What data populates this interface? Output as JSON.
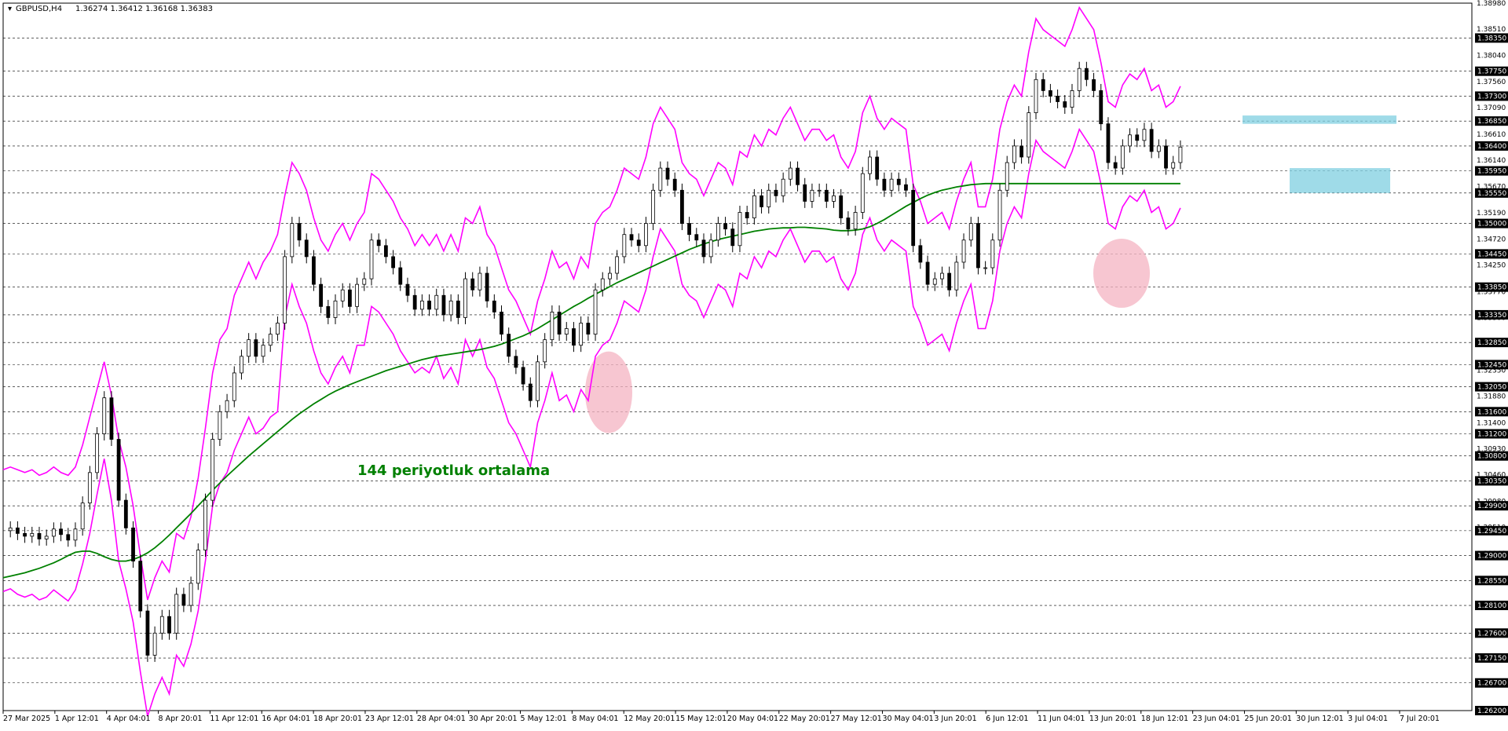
{
  "header": {
    "symbol": "GBPUSD,H4",
    "ohlc": "1.36274 1.36412 1.36168 1.36383"
  },
  "annotation": "144 periyotluk ortalama",
  "colors": {
    "background": "#ffffff",
    "candle": "#000000",
    "bollinger": "#ff00ff",
    "ma": "#008000",
    "annotation": "#008000",
    "highlight_circle": "#f4b3c2",
    "zone": "#7fcfe0"
  },
  "chart_data": {
    "type": "candlestick",
    "symbol": "GBPUSD",
    "timeframe": "H4",
    "ylim": [
      1.262,
      1.3898
    ],
    "grid": true,
    "x_ticks": [
      "27 Mar 2025",
      "1 Apr 12:01",
      "4 Apr 04:01",
      "8 Apr 20:01",
      "11 Apr 12:01",
      "16 Apr 04:01",
      "18 Apr 20:01",
      "23 Apr 12:01",
      "28 Apr 04:01",
      "30 Apr 20:01",
      "5 May 12:01",
      "8 May 04:01",
      "12 May 20:01",
      "15 May 12:01",
      "20 May 04:01",
      "22 May 20:01",
      "27 May 12:01",
      "30 May 04:01",
      "3 Jun 20:01",
      "6 Jun 12:01",
      "11 Jun 04:01",
      "13 Jun 20:01",
      "18 Jun 12:01",
      "23 Jun 04:01",
      "25 Jun 20:01",
      "30 Jun 12:01",
      "3 Jul 04:01",
      "7 Jul 20:01"
    ],
    "y_ticks_boxed": [
      "1.38350",
      "1.37750",
      "1.37300",
      "1.36850",
      "1.36400",
      "1.35950",
      "1.35550",
      "1.35000",
      "1.34450",
      "1.33850",
      "1.33350",
      "1.32850",
      "1.32450",
      "1.32050",
      "1.31600",
      "1.31200",
      "1.30800",
      "1.30350",
      "1.29900",
      "1.29450",
      "1.29000",
      "1.28550",
      "1.28100",
      "1.27600",
      "1.27150",
      "1.26700",
      "1.26200"
    ],
    "y_ticks_plain": [
      "1.38980",
      "1.38510",
      "1.38040",
      "1.37560",
      "1.37090",
      "1.36610",
      "1.36140",
      "1.35670",
      "1.35190",
      "1.34720",
      "1.34250",
      "1.33770",
      "1.33300",
      "1.32830",
      "1.32350",
      "1.31880",
      "1.31400",
      "1.30930",
      "1.30460",
      "1.29980",
      "1.29510",
      "1.29040",
      "1.28560",
      "1.28090",
      "1.27620",
      "1.27140",
      "1.26670"
    ],
    "price_series": {
      "x": [
        0,
        3,
        6,
        9,
        12,
        15,
        18,
        21,
        24,
        27,
        30,
        33,
        36,
        39,
        42,
        45,
        48,
        51,
        54,
        57,
        60,
        63,
        66,
        69,
        72,
        75,
        78,
        81,
        84,
        87,
        90,
        93,
        96,
        99,
        102,
        105,
        108,
        111,
        114,
        117,
        120,
        123,
        126,
        129,
        132,
        135,
        138,
        141,
        144,
        147,
        150,
        153,
        156,
        159,
        162,
        165,
        168,
        171,
        174,
        177,
        180,
        183,
        186,
        189,
        192,
        195,
        198,
        201,
        204,
        207,
        210,
        213,
        216,
        219,
        222,
        225,
        228,
        231,
        234,
        237,
        240,
        243,
        246,
        249,
        252,
        255,
        258,
        261,
        264,
        267,
        270,
        273,
        276,
        279,
        282,
        285,
        288,
        291,
        294,
        297,
        300,
        303,
        306,
        309,
        312,
        315,
        318,
        321,
        324,
        327,
        330,
        333,
        336,
        339,
        342,
        345,
        348,
        351,
        354,
        357,
        360,
        363,
        366,
        369,
        372,
        375,
        378,
        381,
        384,
        387,
        390,
        393,
        396,
        399,
        402,
        405,
        408,
        411,
        414,
        417,
        420,
        423,
        426,
        429,
        432,
        435,
        438,
        441,
        444,
        447,
        450,
        453,
        456,
        459,
        462,
        465,
        468,
        471,
        474,
        477,
        480,
        483,
        486,
        489,
        492,
        495,
        498,
        501,
        504,
        507,
        510,
        513,
        516,
        519,
        522,
        525,
        528,
        531,
        534,
        537,
        540,
        543,
        546,
        549,
        552,
        555,
        558,
        561,
        564,
        567
      ],
      "close": [
        1.2945,
        1.295,
        1.294,
        1.2935,
        1.294,
        1.293,
        1.2935,
        1.2948,
        1.2938,
        1.2928,
        1.2948,
        1.2995,
        1.305,
        1.312,
        1.3185,
        1.311,
        1.3,
        1.295,
        1.289,
        1.28,
        1.272,
        1.276,
        1.279,
        1.276,
        1.283,
        1.281,
        1.285,
        1.291,
        1.3,
        1.311,
        1.316,
        1.318,
        1.323,
        1.326,
        1.329,
        1.326,
        1.328,
        1.33,
        1.332,
        1.344,
        1.35,
        1.347,
        1.344,
        1.339,
        1.335,
        1.333,
        1.336,
        1.338,
        1.335,
        1.339,
        1.34,
        1.347,
        1.346,
        1.344,
        1.342,
        1.339,
        1.337,
        1.3345,
        1.336,
        1.3345,
        1.337,
        1.3335,
        1.336,
        1.333,
        1.34,
        1.338,
        1.341,
        1.336,
        1.334,
        1.33,
        1.326,
        1.324,
        1.321,
        1.318,
        1.325,
        1.329,
        1.334,
        1.33,
        1.331,
        1.328,
        1.332,
        1.33,
        1.338,
        1.34,
        1.341,
        1.344,
        1.348,
        1.347,
        1.346,
        1.35,
        1.356,
        1.36,
        1.358,
        1.356,
        1.35,
        1.348,
        1.347,
        1.344,
        1.347,
        1.35,
        1.349,
        1.346,
        1.352,
        1.351,
        1.355,
        1.353,
        1.356,
        1.355,
        1.358,
        1.36,
        1.357,
        1.354,
        1.356,
        1.356,
        1.354,
        1.355,
        1.351,
        1.349,
        1.352,
        1.359,
        1.362,
        1.358,
        1.356,
        1.358,
        1.357,
        1.356,
        1.346,
        1.343,
        1.339,
        1.34,
        1.341,
        1.338,
        1.343,
        1.347,
        1.35,
        1.342,
        1.342,
        1.347,
        1.356,
        1.361,
        1.364,
        1.362,
        1.37,
        1.376,
        1.374,
        1.373,
        1.372,
        1.371,
        1.374,
        1.378,
        1.376,
        1.374,
        1.368,
        1.361,
        1.36,
        1.364,
        1.366,
        1.365,
        1.367,
        1.363,
        1.364,
        1.36,
        1.361,
        1.3638
      ],
      "ma144": [
        1.286,
        1.2863,
        1.2866,
        1.2869,
        1.2873,
        1.2877,
        1.2882,
        1.2887,
        1.2893,
        1.29,
        1.2906,
        1.2908,
        1.2908,
        1.2904,
        1.2898,
        1.2893,
        1.289,
        1.289,
        1.2893,
        1.2898,
        1.2905,
        1.2914,
        1.2925,
        1.2937,
        1.295,
        1.2963,
        1.2976,
        1.299,
        1.3004,
        1.3018,
        1.3031,
        1.3044,
        1.3056,
        1.3068,
        1.308,
        1.3091,
        1.3102,
        1.3113,
        1.3124,
        1.3135,
        1.3146,
        1.3156,
        1.3165,
        1.3174,
        1.3182,
        1.319,
        1.3197,
        1.3203,
        1.3209,
        1.3214,
        1.3219,
        1.3224,
        1.3229,
        1.3234,
        1.3238,
        1.3242,
        1.3246,
        1.325,
        1.3254,
        1.3257,
        1.326,
        1.3262,
        1.3264,
        1.3266,
        1.3268,
        1.327,
        1.3272,
        1.3275,
        1.3278,
        1.3282,
        1.3287,
        1.3292,
        1.3297,
        1.3303,
        1.331,
        1.3318,
        1.3326,
        1.3334,
        1.3342,
        1.335,
        1.3357,
        1.3365,
        1.3372,
        1.3379,
        1.3386,
        1.3393,
        1.3399,
        1.3405,
        1.3411,
        1.3417,
        1.3423,
        1.3429,
        1.3435,
        1.3441,
        1.3447,
        1.3453,
        1.3458,
        1.3463,
        1.3467,
        1.3471,
        1.3474,
        1.3477,
        1.348,
        1.3483,
        1.3486,
        1.3488,
        1.349,
        1.3491,
        1.3492,
        1.3492,
        1.3493,
        1.3493,
        1.3492,
        1.3491,
        1.349,
        1.3488,
        1.3487,
        1.3487,
        1.3488,
        1.349,
        1.3494,
        1.35,
        1.3507,
        1.3515,
        1.3523,
        1.3531,
        1.3538,
        1.3545,
        1.3551,
        1.3556,
        1.356,
        1.3563,
        1.3566,
        1.3568,
        1.357,
        1.3571,
        1.3572,
        1.3572,
        1.3572,
        1.3572,
        1.3572,
        1.3572,
        1.3572,
        1.3572,
        1.3572,
        1.3572,
        1.3572,
        1.3572,
        1.3572,
        1.3572,
        1.3572,
        1.3572,
        1.3572,
        1.3572,
        1.3572,
        1.3572,
        1.3572,
        1.3572,
        1.3572,
        1.3572,
        1.3572,
        1.3572,
        1.3572,
        1.3572
      ],
      "bb_upper": [
        1.3055,
        1.306,
        1.3055,
        1.305,
        1.3055,
        1.3045,
        1.305,
        1.306,
        1.305,
        1.3045,
        1.306,
        1.31,
        1.315,
        1.32,
        1.325,
        1.319,
        1.311,
        1.306,
        1.299,
        1.29,
        1.282,
        1.286,
        1.289,
        1.287,
        1.294,
        1.293,
        1.297,
        1.304,
        1.313,
        1.323,
        1.329,
        1.331,
        1.337,
        1.34,
        1.343,
        1.34,
        1.343,
        1.345,
        1.348,
        1.355,
        1.361,
        1.359,
        1.356,
        1.351,
        1.347,
        1.345,
        1.348,
        1.35,
        1.347,
        1.35,
        1.352,
        1.359,
        1.358,
        1.356,
        1.354,
        1.351,
        1.349,
        1.346,
        1.348,
        1.346,
        1.348,
        1.345,
        1.348,
        1.345,
        1.351,
        1.35,
        1.353,
        1.348,
        1.346,
        1.342,
        1.338,
        1.336,
        1.333,
        1.33,
        1.336,
        1.34,
        1.345,
        1.342,
        1.343,
        1.34,
        1.344,
        1.342,
        1.35,
        1.352,
        1.353,
        1.356,
        1.36,
        1.359,
        1.358,
        1.362,
        1.368,
        1.371,
        1.369,
        1.367,
        1.361,
        1.359,
        1.358,
        1.355,
        1.358,
        1.361,
        1.36,
        1.357,
        1.363,
        1.362,
        1.366,
        1.364,
        1.367,
        1.366,
        1.369,
        1.371,
        1.368,
        1.365,
        1.367,
        1.367,
        1.365,
        1.366,
        1.362,
        1.36,
        1.363,
        1.37,
        1.373,
        1.369,
        1.367,
        1.369,
        1.368,
        1.367,
        1.357,
        1.354,
        1.35,
        1.351,
        1.352,
        1.349,
        1.354,
        1.358,
        1.361,
        1.353,
        1.353,
        1.358,
        1.367,
        1.372,
        1.375,
        1.373,
        1.381,
        1.387,
        1.385,
        1.384,
        1.383,
        1.382,
        1.385,
        1.389,
        1.387,
        1.385,
        1.379,
        1.372,
        1.371,
        1.375,
        1.377,
        1.376,
        1.378,
        1.374,
        1.375,
        1.371,
        1.372,
        1.3748
      ],
      "bb_lower": [
        1.2835,
        1.284,
        1.283,
        1.2825,
        1.283,
        1.282,
        1.2825,
        1.2838,
        1.2828,
        1.2818,
        1.2838,
        1.2885,
        1.294,
        1.301,
        1.3075,
        1.3,
        1.289,
        1.284,
        1.278,
        1.269,
        1.261,
        1.265,
        1.268,
        1.265,
        1.272,
        1.27,
        1.274,
        1.28,
        1.289,
        1.299,
        1.303,
        1.305,
        1.309,
        1.312,
        1.315,
        1.312,
        1.313,
        1.315,
        1.316,
        1.333,
        1.339,
        1.335,
        1.332,
        1.327,
        1.323,
        1.321,
        1.324,
        1.326,
        1.323,
        1.328,
        1.328,
        1.335,
        1.334,
        1.332,
        1.33,
        1.327,
        1.325,
        1.323,
        1.324,
        1.323,
        1.326,
        1.322,
        1.324,
        1.321,
        1.329,
        1.326,
        1.329,
        1.324,
        1.322,
        1.318,
        1.314,
        1.312,
        1.309,
        1.306,
        1.314,
        1.318,
        1.323,
        1.318,
        1.319,
        1.316,
        1.32,
        1.318,
        1.326,
        1.328,
        1.329,
        1.332,
        1.336,
        1.335,
        1.334,
        1.338,
        1.344,
        1.349,
        1.347,
        1.345,
        1.339,
        1.337,
        1.336,
        1.333,
        1.336,
        1.339,
        1.338,
        1.335,
        1.341,
        1.34,
        1.344,
        1.342,
        1.345,
        1.344,
        1.347,
        1.349,
        1.346,
        1.343,
        1.345,
        1.345,
        1.343,
        1.344,
        1.34,
        1.338,
        1.341,
        1.348,
        1.351,
        1.347,
        1.345,
        1.347,
        1.346,
        1.345,
        1.335,
        1.332,
        1.328,
        1.329,
        1.33,
        1.327,
        1.332,
        1.336,
        1.339,
        1.331,
        1.331,
        1.336,
        1.345,
        1.35,
        1.353,
        1.351,
        1.359,
        1.365,
        1.363,
        1.362,
        1.361,
        1.36,
        1.363,
        1.367,
        1.365,
        1.363,
        1.357,
        1.35,
        1.349,
        1.353,
        1.355,
        1.354,
        1.356,
        1.352,
        1.353,
        1.349,
        1.35,
        1.3528
      ]
    },
    "highlights": [
      {
        "type": "circle",
        "center_price": 1.3195
      },
      {
        "type": "circle",
        "center_price": 1.341
      }
    ],
    "zones": [
      {
        "label": "",
        "price_top": 1.3695,
        "price_bottom": 1.368
      },
      {
        "label": "",
        "price_top": 1.36,
        "price_bottom": 1.3555
      }
    ]
  }
}
